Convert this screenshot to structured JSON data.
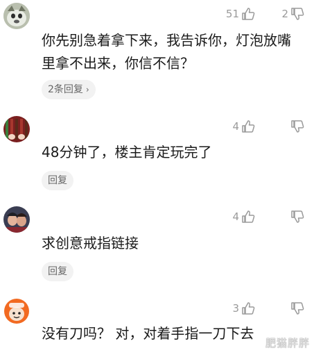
{
  "comments": [
    {
      "likes": "51",
      "dislikes": "2",
      "text": "你先别急着拿下来，我告诉你，灯泡放嘴里拿不出来，你信不信？",
      "reply_label": "2条回复",
      "reply_chevron": "›"
    },
    {
      "likes": "4",
      "dislikes": "",
      "text": "48分钟了，楼主肯定玩完了",
      "reply_label": "回复"
    },
    {
      "likes": "4",
      "dislikes": "",
      "text": "求创意戒指链接",
      "reply_label": "回复"
    },
    {
      "likes": "3",
      "dislikes": "",
      "text": "没有刀吗？ 对，对着手指一刀下去",
      "reply_label": ""
    }
  ],
  "watermark": "肥猫胖胖",
  "icons": {
    "like": "thumbs-up-icon",
    "dislike": "thumbs-down-icon"
  },
  "colors": {
    "meta_gray": "#9a9a9a",
    "pill_bg": "#f2f2f2"
  }
}
